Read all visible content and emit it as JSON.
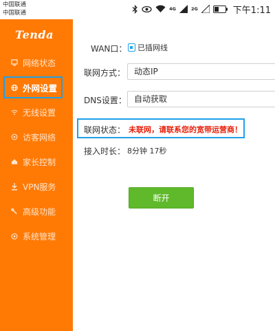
{
  "status_bar": {
    "carrier_1": "中国联通",
    "carrier_2": "中国联通",
    "network_label": "4G",
    "network_label_2": "2G",
    "time": "下午1:11"
  },
  "sidebar": {
    "logo": "Tenda",
    "items": [
      {
        "label": "网络状态",
        "icon": "network-status-icon",
        "active": false
      },
      {
        "label": "外网设置",
        "icon": "globe-icon",
        "active": true
      },
      {
        "label": "无线设置",
        "icon": "wifi-icon",
        "active": false
      },
      {
        "label": "访客网络",
        "icon": "guest-icon",
        "active": false
      },
      {
        "label": "家长控制",
        "icon": "parental-icon",
        "active": false
      },
      {
        "label": "VPN服务",
        "icon": "vpn-icon",
        "active": false
      },
      {
        "label": "高级功能",
        "icon": "wrench-icon",
        "active": false
      },
      {
        "label": "系统管理",
        "icon": "settings-icon",
        "active": false
      }
    ]
  },
  "main": {
    "wan_label": "WAN口：",
    "wan_status": "已插网线",
    "connection_type_label": "联网方式：",
    "connection_type_value": "动态IP",
    "dns_label": "DNS设置：",
    "dns_value": "自动获取",
    "link_status_label": "联网状态：",
    "link_status_value": "未联网，请联系您的宽带运营商！",
    "uptime_label": "接入时长：",
    "uptime_value": "8分钟 17秒",
    "disconnect_button": "断开"
  },
  "colors": {
    "sidebar_bg": "#ff7a05",
    "highlight_border": "#1ea0e8",
    "error_text": "#e8210c",
    "button_bg": "#5fb92b"
  }
}
